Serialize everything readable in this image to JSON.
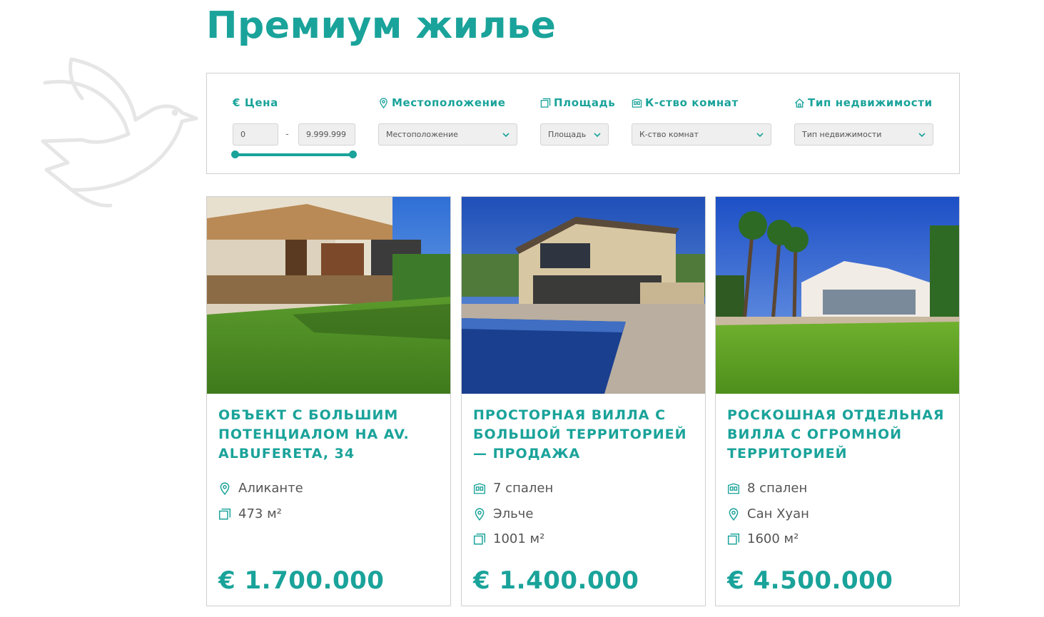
{
  "page": {
    "title": "Премиум жилье"
  },
  "filters": {
    "price": {
      "label": "€ Цена",
      "min": "0",
      "max": "9.999.999"
    },
    "location": {
      "label": "Местоположение",
      "placeholder": "Местоположение"
    },
    "area": {
      "label": "Площадь",
      "placeholder": "Площадь"
    },
    "rooms": {
      "label": "К-ство комнат",
      "placeholder": "К-ство комнат"
    },
    "type": {
      "label": "Тип недвижимости",
      "placeholder": "Тип недвижимости"
    },
    "range_separator": "-"
  },
  "listings": [
    {
      "title": "ОБЪЕКТ С БОЛЬШИМ ПОТЕНЦИАЛОМ НА AV. ALBUFERETA, 34",
      "features": [
        {
          "icon": "location-pin-icon",
          "text": "Аликанте"
        },
        {
          "icon": "area-icon",
          "text": "473 м²"
        }
      ],
      "price": "€ 1.700.000"
    },
    {
      "title": "ПРОСТОРНАЯ ВИЛЛА С БОЛЬШОЙ ТЕРРИТОРИЕЙ — ПРОДАЖА",
      "features": [
        {
          "icon": "bedrooms-icon",
          "text": "7 спален"
        },
        {
          "icon": "location-pin-icon",
          "text": "Эльче"
        },
        {
          "icon": "area-icon",
          "text": "1001 м²"
        }
      ],
      "price": "€ 1.400.000"
    },
    {
      "title": "РОСКОШНАЯ ОТДЕЛЬНАЯ ВИЛЛА С ОГРОМНОЙ ТЕРРИТОРИЕЙ",
      "features": [
        {
          "icon": "bedrooms-icon",
          "text": "8 спален"
        },
        {
          "icon": "location-pin-icon",
          "text": "Сан Хуан"
        },
        {
          "icon": "area-icon",
          "text": "1600 м²"
        }
      ],
      "price": "€ 4.500.000"
    }
  ],
  "colors": {
    "accent": "#1aa39a",
    "text": "#555555",
    "border": "#cfcfcf"
  }
}
